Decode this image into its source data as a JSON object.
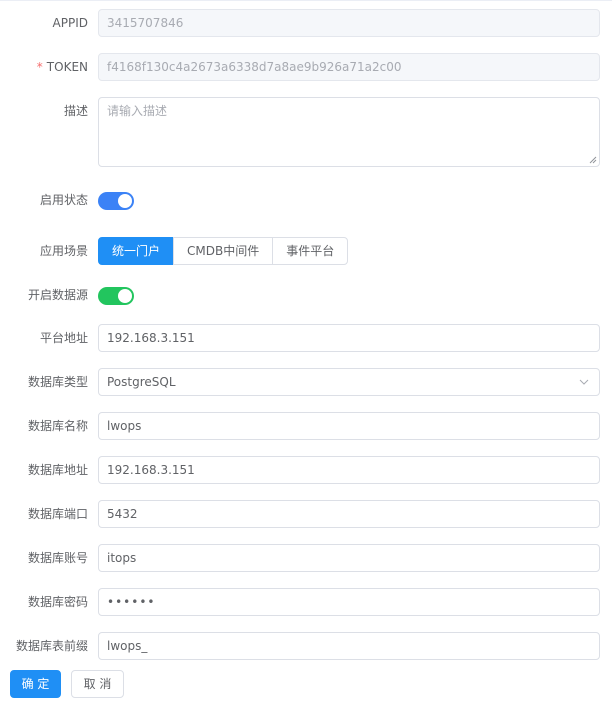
{
  "colors": {
    "primary": "#1f8ff5",
    "switch_on_blue": "#3b82f6",
    "switch_on_green": "#22c55e"
  },
  "form": {
    "appid": {
      "label": "APPID",
      "value": "3415707846"
    },
    "token": {
      "required_mark": "*",
      "label": "TOKEN",
      "value": "f4168f130c4a2673a6338d7a8ae9b926a71a2c00"
    },
    "description": {
      "label": "描述",
      "placeholder": "请输入描述"
    },
    "enabled": {
      "label": "启用状态",
      "on": true
    },
    "scenario": {
      "label": "应用场景",
      "options": [
        "统一门户",
        "CMDB中间件",
        "事件平台"
      ],
      "selected": "统一门户"
    },
    "datasource_enabled": {
      "label": "开启数据源",
      "on": true
    },
    "platform_address": {
      "label": "平台地址",
      "value": "192.168.3.151"
    },
    "db_type": {
      "label": "数据库类型",
      "value": "PostgreSQL",
      "icon": "chevron-down-icon"
    },
    "db_name": {
      "label": "数据库名称",
      "value": "lwops"
    },
    "db_address": {
      "label": "数据库地址",
      "value": "192.168.3.151"
    },
    "db_port": {
      "label": "数据库端口",
      "value": "5432"
    },
    "db_account": {
      "label": "数据库账号",
      "value": "itops"
    },
    "db_password": {
      "label": "数据库密码",
      "value": "••••••"
    },
    "db_table_prefix": {
      "label": "数据库表前缀",
      "value": "lwops_"
    }
  },
  "actions": {
    "confirm": "确 定",
    "cancel": "取 消"
  }
}
